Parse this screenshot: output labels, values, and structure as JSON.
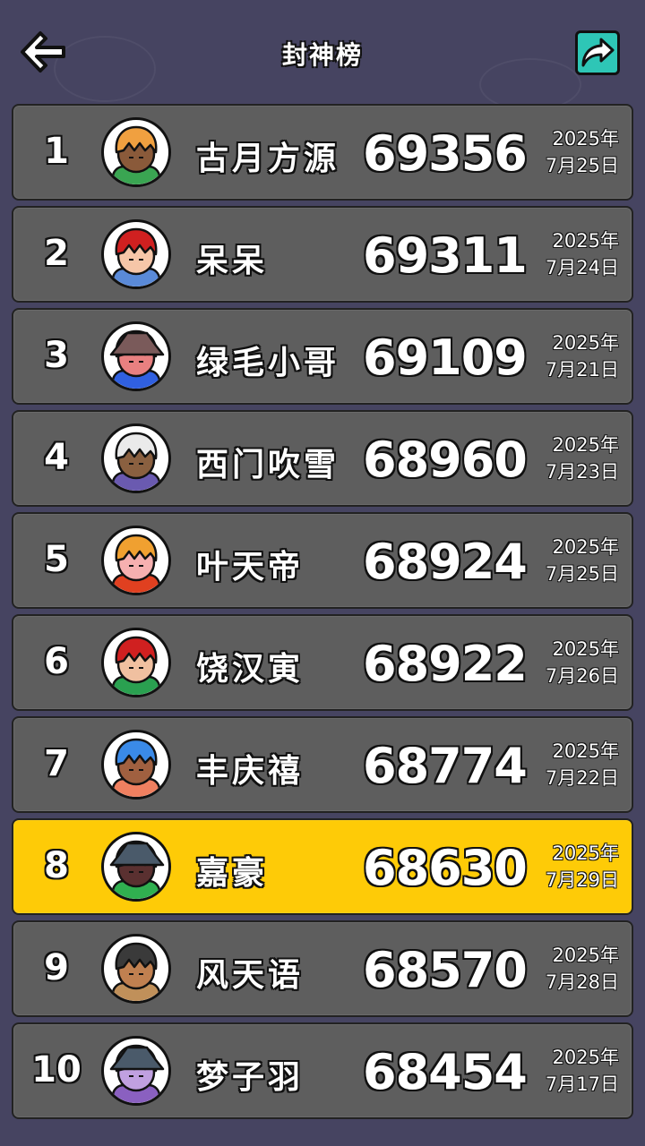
{
  "header": {
    "title": "封神榜",
    "back_icon": "back-arrow-icon",
    "share_icon": "share-arrow-icon",
    "share_color": "#2ec6b6"
  },
  "colors": {
    "row_bg": "#5e5e5e",
    "highlight_bg": "#fecb07",
    "background": "#464461"
  },
  "rows": [
    {
      "rank": "1",
      "name": "古月方源",
      "score": "69356",
      "date_year": "2025年",
      "date_day": "7月25日",
      "hair": "#f0a040",
      "skin": "#8a5a3a",
      "shirt": "#3aa552",
      "hat": "none"
    },
    {
      "rank": "2",
      "name": "呆呆",
      "score": "69311",
      "date_year": "2025年",
      "date_day": "7月24日",
      "hair": "#d02020",
      "skin": "#f6c6a8",
      "shirt": "#5a8ad8",
      "hat": "none"
    },
    {
      "rank": "3",
      "name": "绿毛小哥",
      "score": "69109",
      "date_year": "2025年",
      "date_day": "7月21日",
      "hair": "#7a5a5a",
      "skin": "#e88080",
      "shirt": "#3060e0",
      "hat": "#7a5a5a"
    },
    {
      "rank": "4",
      "name": "西门吹雪",
      "score": "68960",
      "date_year": "2025年",
      "date_day": "7月23日",
      "hair": "#eaeaea",
      "skin": "#8a6040",
      "shirt": "#6a5ab0",
      "hat": "none"
    },
    {
      "rank": "5",
      "name": "叶天帝",
      "score": "68924",
      "date_year": "2025年",
      "date_day": "7月25日",
      "hair": "#f0a030",
      "skin": "#f6b0b0",
      "shirt": "#e04020",
      "hat": "none"
    },
    {
      "rank": "6",
      "name": "饶汉寅",
      "score": "68922",
      "date_year": "2025年",
      "date_day": "7月26日",
      "hair": "#d02020",
      "skin": "#f0c0a0",
      "shirt": "#2aa050",
      "hat": "none"
    },
    {
      "rank": "7",
      "name": "丰庆禧",
      "score": "68774",
      "date_year": "2025年",
      "date_day": "7月22日",
      "hair": "#3a8ae8",
      "skin": "#a06040",
      "shirt": "#f08060",
      "hat": "none"
    },
    {
      "rank": "8",
      "name": "嘉豪",
      "score": "68630",
      "date_year": "2025年",
      "date_day": "7月29日",
      "hair": "#4a5a6a",
      "skin": "#5a3030",
      "shirt": "#30b050",
      "hat": "#4a5a6a",
      "highlight": true
    },
    {
      "rank": "9",
      "name": "风天语",
      "score": "68570",
      "date_year": "2025年",
      "date_day": "7月28日",
      "hair": "#3a3a3a",
      "skin": "#c08050",
      "shirt": "#c0905a",
      "hat": "none"
    },
    {
      "rank": "10",
      "name": "梦子羽",
      "score": "68454",
      "date_year": "2025年",
      "date_day": "7月17日",
      "hair": "#4a5a6a",
      "skin": "#c0a0e0",
      "shirt": "#8a60c0",
      "hat": "#4a5a6a"
    }
  ]
}
